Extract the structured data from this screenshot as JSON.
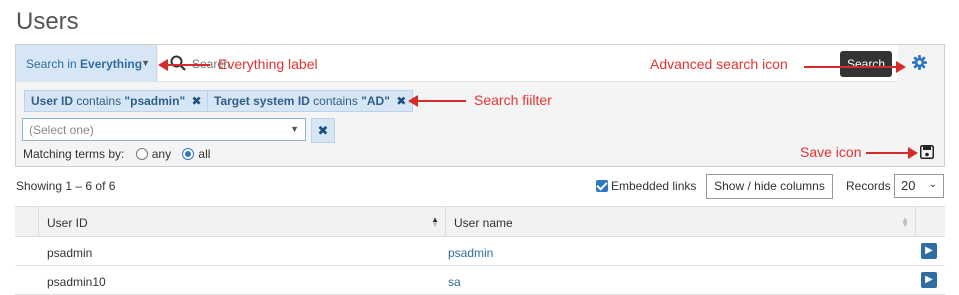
{
  "page": {
    "title": "Users"
  },
  "search": {
    "scope_prefix": "Search in",
    "scope_value": "Everything",
    "placeholder": "Search",
    "button_label": "Search"
  },
  "filters": [
    {
      "field": "User ID",
      "op": "contains",
      "value": "\"psadmin\""
    },
    {
      "field": "Target system ID",
      "op": "contains",
      "value": "\"AD\""
    }
  ],
  "filter_select": {
    "placeholder": "(Select one)"
  },
  "matching": {
    "label": "Matching terms by:",
    "options": [
      "any",
      "all"
    ],
    "selected": "all"
  },
  "list_controls": {
    "showing": "Showing 1 – 6 of 6",
    "embedded_links_label": "Embedded links",
    "embedded_links_checked": true,
    "columns_button": "Show / hide columns",
    "records_label": "Records",
    "records_value": "20"
  },
  "table": {
    "columns": [
      "User ID",
      "User name"
    ],
    "rows": [
      {
        "user_id": "psadmin",
        "user_name": "psadmin"
      },
      {
        "user_id": "psadmin10",
        "user_name": "sa"
      }
    ]
  },
  "annotations": {
    "everything_label": "Everything label",
    "advanced_search_icon": "Advanced search icon",
    "search_filter": "Search fiilter",
    "save_icon": "Save icon"
  },
  "colors": {
    "accent": "#2f6ea4",
    "chip_bg": "#d6e6f5",
    "annotation": "#e63333"
  },
  "icons": [
    "search-icon",
    "gear-icon",
    "close-icon",
    "chevron-down-icon",
    "save-icon",
    "sort-icon",
    "arrow-right-icon"
  ]
}
